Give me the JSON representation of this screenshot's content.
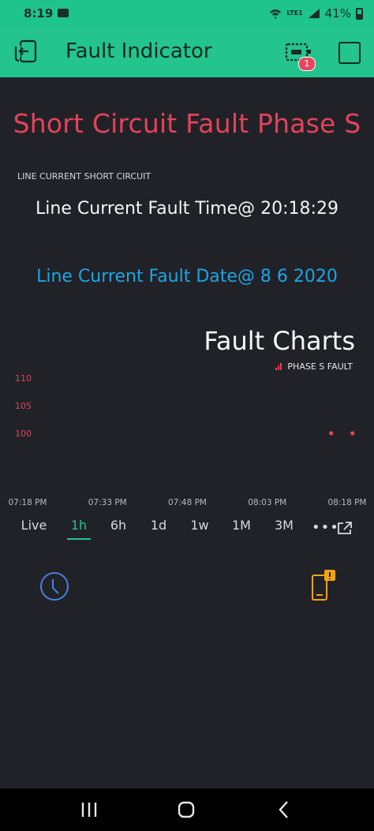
{
  "status": {
    "time": "8:19",
    "battery": "41%",
    "network": "LTE1"
  },
  "appbar": {
    "title": "Fault Indicator",
    "badge": "1"
  },
  "fault": {
    "title": "Short Circuit Fault Phase S",
    "label": "LINE CURRENT SHORT CIRCUIT",
    "time": "Line Current Fault Time@ 20:18:29",
    "date": "Line Current Fault Date@ 8 6 2020"
  },
  "chart_data": {
    "type": "scatter",
    "title": "Fault Charts",
    "series": [
      {
        "name": "PHASE S FAULT",
        "color": "#e4435b",
        "points": [
          {
            "x": "08:15 PM",
            "y": 100
          },
          {
            "x": "08:19 PM",
            "y": 100
          }
        ]
      }
    ],
    "x_tick_labels": [
      "07:18 PM",
      "07:33 PM",
      "07:48 PM",
      "08:03 PM",
      "08:18 PM"
    ],
    "y_tick_labels": [
      "110",
      "105",
      "100"
    ],
    "ylim": [
      95,
      110
    ]
  },
  "ranges": {
    "items": [
      "Live",
      "1h",
      "6h",
      "1d",
      "1w",
      "1M",
      "3M"
    ],
    "active": "1h",
    "more_label": "•••"
  },
  "colors": {
    "accent": "#23c48e",
    "fault_red": "#e4435b",
    "date_blue": "#1aa6e6",
    "background": "#212227"
  },
  "icons": [
    "back-icon",
    "device-icon",
    "square-icon",
    "clock-icon",
    "phone-alert-icon",
    "expand-icon"
  ]
}
